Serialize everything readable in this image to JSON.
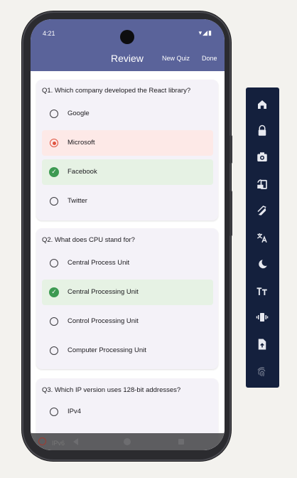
{
  "status_bar": {
    "time": "4:21",
    "icons": "▾◢▮"
  },
  "app_bar": {
    "title": "Review",
    "actions": [
      "New Quiz",
      "Done"
    ]
  },
  "questions": [
    {
      "text": "Q1. Which company developed the React library?",
      "options": [
        {
          "label": "Google",
          "state": "none"
        },
        {
          "label": "Microsoft",
          "state": "selected-wrong"
        },
        {
          "label": "Facebook",
          "state": "correct"
        },
        {
          "label": "Twitter",
          "state": "none"
        }
      ]
    },
    {
      "text": "Q2. What does CPU stand for?",
      "options": [
        {
          "label": "Central Process Unit",
          "state": "none"
        },
        {
          "label": "Central Processing Unit",
          "state": "correct"
        },
        {
          "label": "Control Processing Unit",
          "state": "none"
        },
        {
          "label": "Computer Processing Unit",
          "state": "none"
        }
      ]
    },
    {
      "text": "Q3. Which IP version uses 128-bit addresses?",
      "options": [
        {
          "label": "IPv4",
          "state": "none"
        },
        {
          "label": "IPv6",
          "state": "selected"
        }
      ]
    }
  ],
  "colors": {
    "app_bar": "#5a639a",
    "wrong_bg": "#fde9e7",
    "correct_bg": "#e6f2e4",
    "correct_icon": "#3d9a52",
    "selected_radio": "#e0533f",
    "toolbar": "#14203d"
  },
  "emulator_toolbar": [
    "home-icon",
    "lock-icon",
    "camera-icon",
    "rotate-icon",
    "fold-icon",
    "translate-icon",
    "dark-mode-icon",
    "font-size-icon",
    "vibrate-icon",
    "file-upload-icon",
    "fingerprint-icon"
  ]
}
